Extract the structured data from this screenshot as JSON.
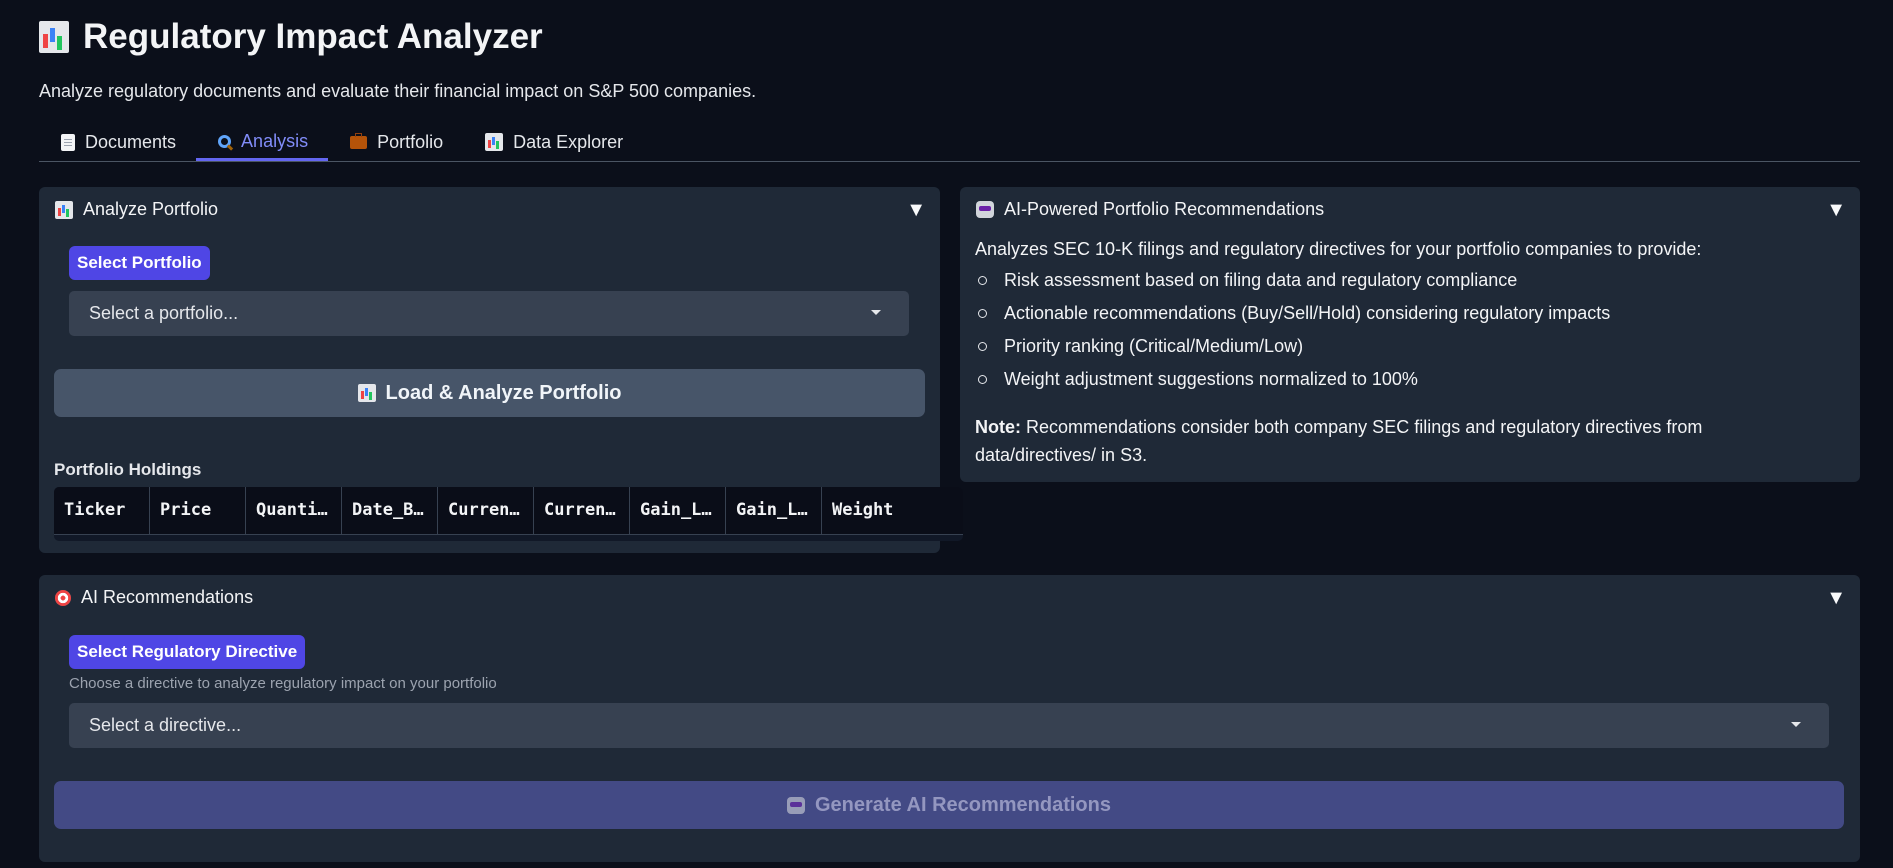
{
  "header": {
    "title": "Regulatory Impact Analyzer",
    "title_icon": "bar-chart-icon",
    "subtitle": "Analyze regulatory documents and evaluate their financial impact on S&P 500 companies."
  },
  "tabs": [
    {
      "label": "Documents",
      "icon": "document-icon"
    },
    {
      "label": "Analysis",
      "icon": "magnifier-icon",
      "active": true
    },
    {
      "label": "Portfolio",
      "icon": "briefcase-icon"
    },
    {
      "label": "Data Explorer",
      "icon": "bar-chart-icon"
    }
  ],
  "analyze_portfolio": {
    "title": "Analyze Portfolio",
    "select_label": "Select Portfolio",
    "select_placeholder": "Select a portfolio...",
    "button_label": "Load & Analyze Portfolio",
    "holdings_label": "Portfolio Holdings",
    "columns": [
      "Ticker",
      "Price",
      "Quanti…",
      "Date_B…",
      "Curren…",
      "Curren…",
      "Gain_L…",
      "Gain_L…",
      "Weight"
    ]
  },
  "recommendations_info": {
    "title": "AI-Powered Portfolio Recommendations",
    "intro": "Analyzes SEC 10-K filings and regulatory directives for your portfolio companies to provide:",
    "bullets": [
      "Risk assessment based on filing data and regulatory compliance",
      "Actionable recommendations (Buy/Sell/Hold) considering regulatory impacts",
      "Priority ranking (Critical/Medium/Low)",
      "Weight adjustment suggestions normalized to 100%"
    ],
    "note_label": "Note:",
    "note_line1": " Recommendations consider both company SEC filings and regulatory directives from",
    "note_line2": "data/directives/ in S3."
  },
  "ai_recommendations": {
    "title": "AI Recommendations",
    "select_label": "Select Regulatory Directive",
    "hint": "Choose a directive to analyze regulatory impact on your portfolio",
    "select_placeholder": "Select a directive...",
    "button_label": "Generate AI Recommendations"
  },
  "colors": {
    "background": "#0b0f1a",
    "panel": "#1f2937",
    "accent": "#4f46e5",
    "active_tab": "#818cf8"
  }
}
